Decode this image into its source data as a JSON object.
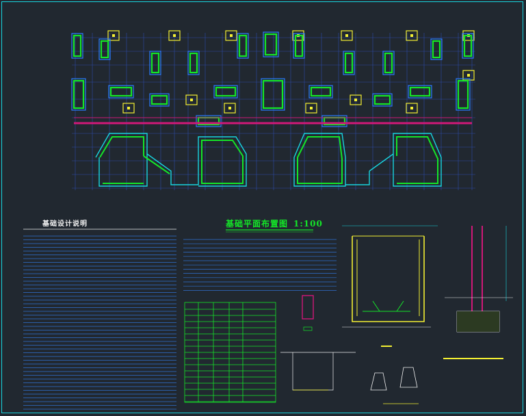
{
  "drawing": {
    "notes_title": "基础设计说明",
    "plan_title": "基础平面布置图",
    "plan_scale": "1:100"
  },
  "colors": {
    "background": "#212830",
    "frame": "#18d6e0",
    "grid": "#2c4aa8",
    "column": "#14e628",
    "outline": "#2a7cff",
    "yellow": "#f4f032",
    "magenta": "#d01878",
    "cyan": "#18d6e0",
    "notes_lines": "#3070d0",
    "white": "#f0f0f0"
  }
}
